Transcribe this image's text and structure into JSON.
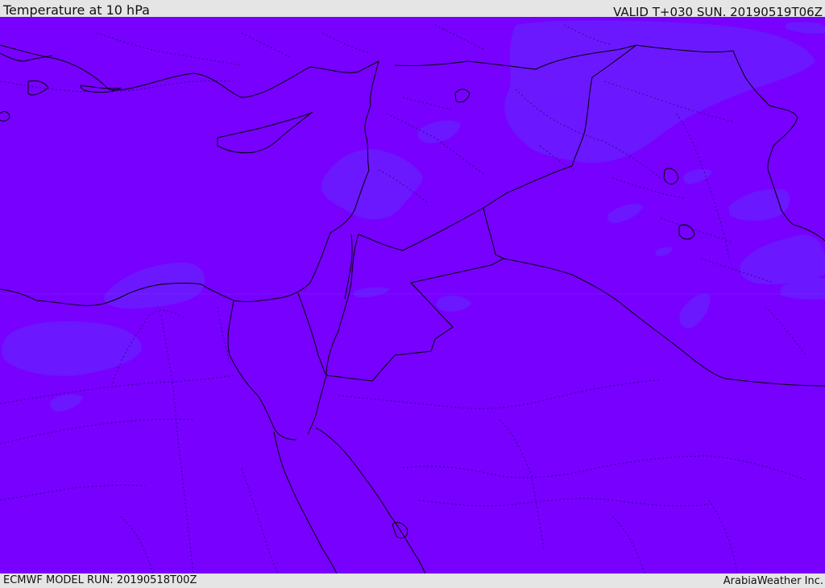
{
  "header": {
    "title": "Temperature at 10 hPa",
    "valid_time": "VALID T+030 SUN. 20190519T06Z"
  },
  "footer": {
    "model_run": "ECMWF MODEL RUN: 20190518T00Z",
    "credit": "ArabiaWeather Inc."
  },
  "map": {
    "variable": "Temperature",
    "level": "10 hPa",
    "colors": {
      "base_field": "#7700ff",
      "warm_patches": "#6a1cff",
      "borders": "#000000",
      "background_bar": "#e5e5e5"
    }
  }
}
